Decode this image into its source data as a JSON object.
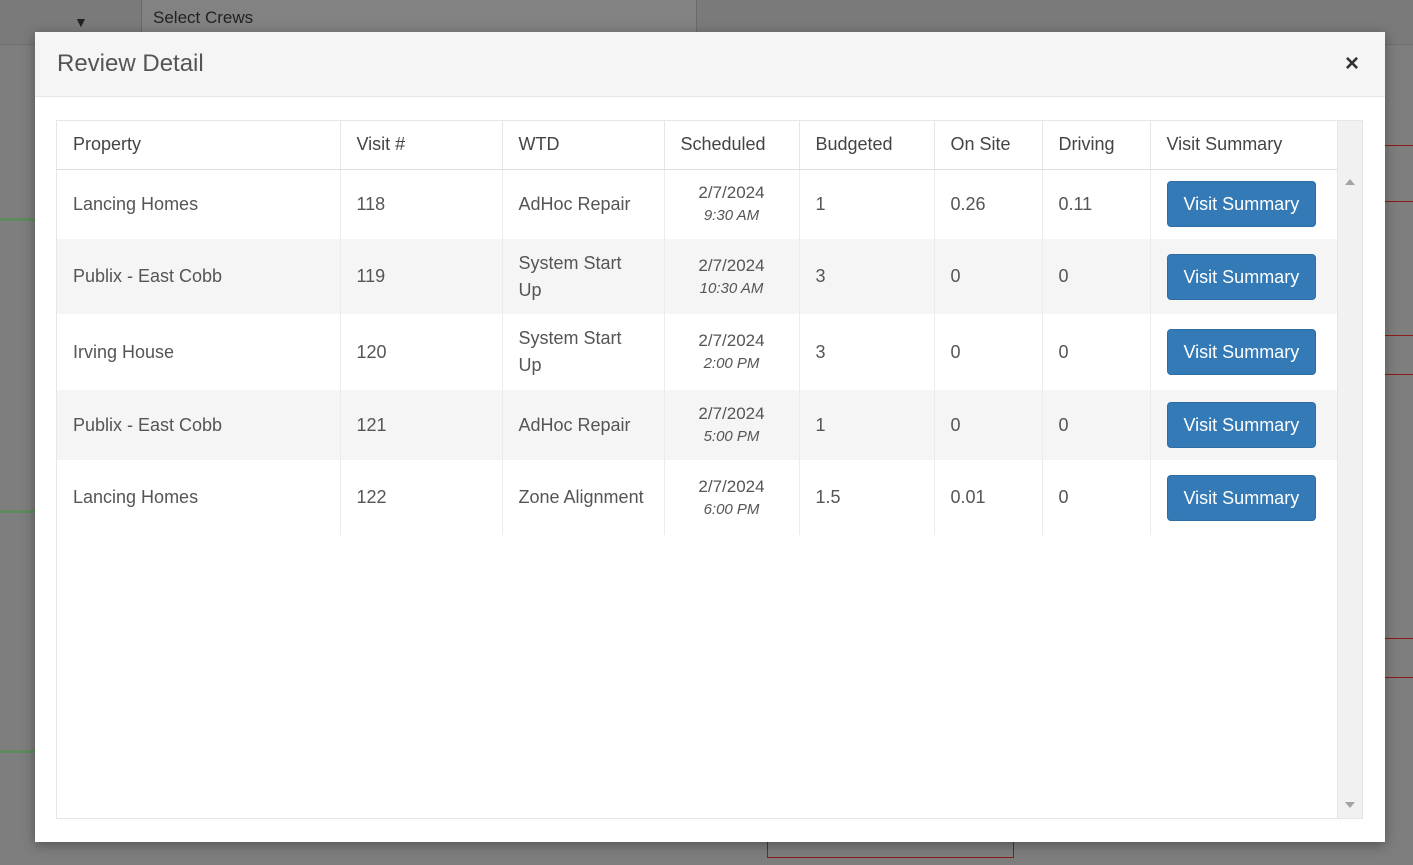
{
  "background": {
    "select_placeholder": "Select Crews",
    "dropdown_caret": "▼"
  },
  "modal": {
    "title": "Review Detail",
    "close_symbol": "×"
  },
  "table": {
    "columns": [
      "Property",
      "Visit #",
      "WTD",
      "Scheduled",
      "Budgeted",
      "On Site",
      "Driving",
      "Visit Summary"
    ],
    "rows": [
      {
        "property": "Lancing Homes",
        "visit": "118",
        "wtd": "AdHoc Repair",
        "date": "2/7/2024",
        "time": "9:30 AM",
        "budgeted": "1",
        "on_site": "0.26",
        "driving": "0.11",
        "action": "Visit Summary"
      },
      {
        "property": "Publix - East Cobb",
        "visit": "119",
        "wtd": "System Start Up",
        "date": "2/7/2024",
        "time": "10:30 AM",
        "budgeted": "3",
        "on_site": "0",
        "driving": "0",
        "action": "Visit Summary"
      },
      {
        "property": "Irving House",
        "visit": "120",
        "wtd": "System Start Up",
        "date": "2/7/2024",
        "time": "2:00 PM",
        "budgeted": "3",
        "on_site": "0",
        "driving": "0",
        "action": "Visit Summary"
      },
      {
        "property": "Publix - East Cobb",
        "visit": "121",
        "wtd": "AdHoc Repair",
        "date": "2/7/2024",
        "time": "5:00 PM",
        "budgeted": "1",
        "on_site": "0",
        "driving": "0",
        "action": "Visit Summary"
      },
      {
        "property": "Lancing Homes",
        "visit": "122",
        "wtd": "Zone Alignment",
        "date": "2/7/2024",
        "time": "6:00 PM",
        "budgeted": "1.5",
        "on_site": "0.01",
        "driving": "0",
        "action": "Visit Summary"
      }
    ]
  },
  "colors": {
    "button": "#337ab7",
    "header_bg": "#f5f5f5",
    "overlay": "#808080"
  }
}
